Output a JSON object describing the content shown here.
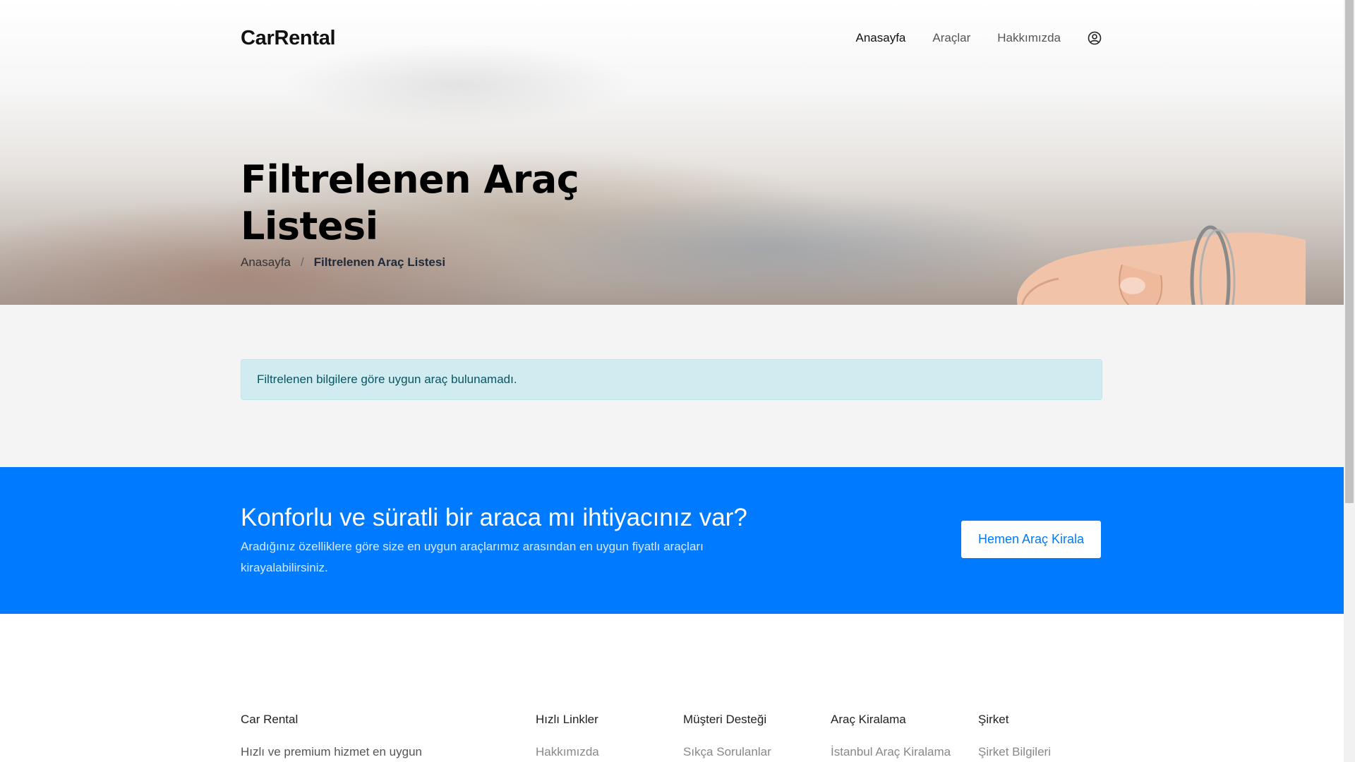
{
  "header": {
    "brand": "CarRental",
    "nav": [
      {
        "label": "Anasayfa",
        "active": true
      },
      {
        "label": "Araçlar",
        "active": false
      },
      {
        "label": "Hakkımızda",
        "active": false
      }
    ],
    "user_icon": "user-circle-icon"
  },
  "hero": {
    "title": "Filtrelenen Araç Listesi",
    "breadcrumb": {
      "home": "Anasayfa",
      "separator": "/",
      "current": "Filtrelenen Araç Listesi"
    }
  },
  "alert": {
    "message": "Filtrelenen bilgilere göre uygun araç bulunamadı."
  },
  "cta": {
    "title": "Konforlu ve süratli bir araca mı ihtiyacınız var?",
    "text": "Aradığınız özelliklere göre size en uygun araçlarımız arasından en uygun fiyatlı araçları kirayalabilirsiniz.",
    "button": "Hemen Araç Kirala",
    "color": "#007bff"
  },
  "footer": {
    "about": {
      "heading": "Car Rental",
      "text": "Hızlı ve premium hizmet en uygun"
    },
    "quick_links": {
      "heading": "Hızlı Linkler",
      "first": "Hakkımızda"
    },
    "support": {
      "heading": "Müşteri Desteği",
      "first": "Sıkça Sorulanlar"
    },
    "rental": {
      "heading": "Araç Kiralama",
      "first": "İstanbul Araç Kiralama"
    },
    "company": {
      "heading": "Şirket",
      "first": "Şirket Bilgileri"
    }
  }
}
